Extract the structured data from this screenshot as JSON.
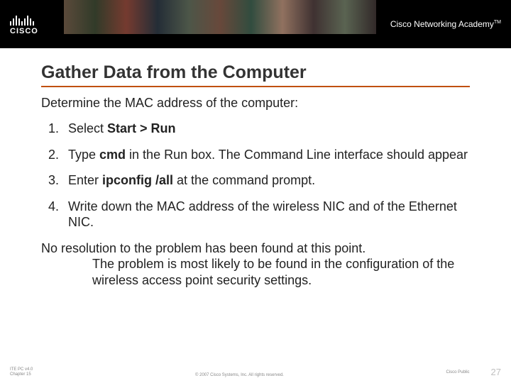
{
  "header": {
    "logo_text": "CISCO",
    "academy": "Cisco Networking Academy",
    "tm": "TM"
  },
  "content": {
    "title": "Gather Data from the Computer",
    "subtitle": "Determine the MAC address of the computer:",
    "steps": [
      {
        "pre": "Select ",
        "bold": "Start > Run",
        "post": ""
      },
      {
        "pre": "Type ",
        "bold": "cmd",
        "post": " in the Run box. The Command Line interface should appear"
      },
      {
        "pre": "Enter ",
        "bold": "ipconfig /all",
        "post": " at the command prompt."
      },
      {
        "pre": "Write down the MAC address of the wireless NIC and of the Ethernet NIC.",
        "bold": "",
        "post": ""
      }
    ],
    "conclusion_first": "No resolution to the problem has been found at this point.",
    "conclusion_rest": "The problem is most likely to be found in the configuration of the wireless access point security settings."
  },
  "footer": {
    "left_line1": "ITE PC v4.0",
    "left_line2": "Chapter 15",
    "center": "© 2007 Cisco Systems, Inc. All rights reserved.",
    "right_label": "Cisco Public",
    "page": "27"
  }
}
